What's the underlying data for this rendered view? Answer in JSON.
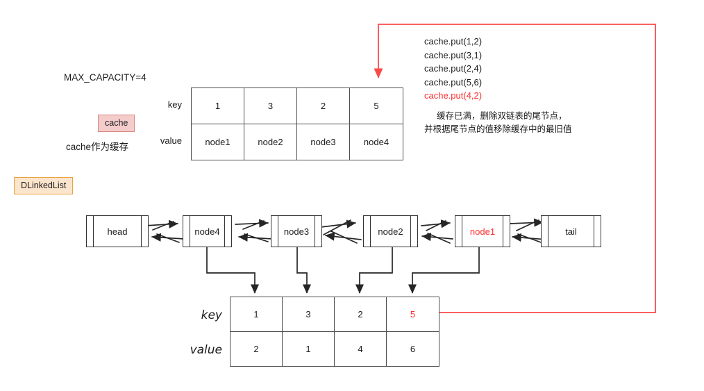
{
  "labels": {
    "max_capacity": "MAX_CAPACITY=4",
    "cache_note": "cache作为缓存",
    "cache_badge": "cache",
    "dlinkedlist_badge": "DLinkedList",
    "key_row": "key",
    "value_row": "value",
    "key_row_bottom": "key",
    "value_row_bottom": "value"
  },
  "code": {
    "lines": [
      {
        "text": "cache.put(1,2)",
        "highlight": false
      },
      {
        "text": "cache.put(3,1)",
        "highlight": false
      },
      {
        "text": "cache.put(2,4)",
        "highlight": false
      },
      {
        "text": "cache.put(5,6)",
        "highlight": false
      },
      {
        "text": "cache.put(4,2)",
        "highlight": true
      }
    ],
    "note_line1": "缓存已满，删除双链表的尾节点，",
    "note_line2": "并根据尾节点的值移除缓存中的最旧值"
  },
  "cache_table": {
    "keys": [
      "1",
      "3",
      "2",
      "5"
    ],
    "values": [
      "node1",
      "node2",
      "node3",
      "node4"
    ]
  },
  "linked_list": {
    "nodes": [
      {
        "label": "head",
        "red": false
      },
      {
        "label": "node4",
        "red": false
      },
      {
        "label": "node3",
        "red": false
      },
      {
        "label": "node2",
        "red": false
      },
      {
        "label": "node1",
        "red": true
      },
      {
        "label": "tail",
        "red": false
      }
    ]
  },
  "kv_table": {
    "keys": [
      {
        "text": "1",
        "red": false
      },
      {
        "text": "3",
        "red": false
      },
      {
        "text": "2",
        "red": false
      },
      {
        "text": "5",
        "red": true
      }
    ],
    "values": [
      {
        "text": "2",
        "red": false
      },
      {
        "text": "1",
        "red": false
      },
      {
        "text": "4",
        "red": false
      },
      {
        "text": "6",
        "red": false
      }
    ]
  },
  "colors": {
    "accent_red": "#ff2d2d",
    "line_red": "#fa4b4b",
    "stroke_dark": "#333333",
    "table_border": "#4d4d4d",
    "cache_badge_bg": "#f4cccc",
    "cache_badge_border": "#d98880",
    "dll_badge_bg": "#fce5cd",
    "dll_badge_border": "#e8a33d"
  }
}
